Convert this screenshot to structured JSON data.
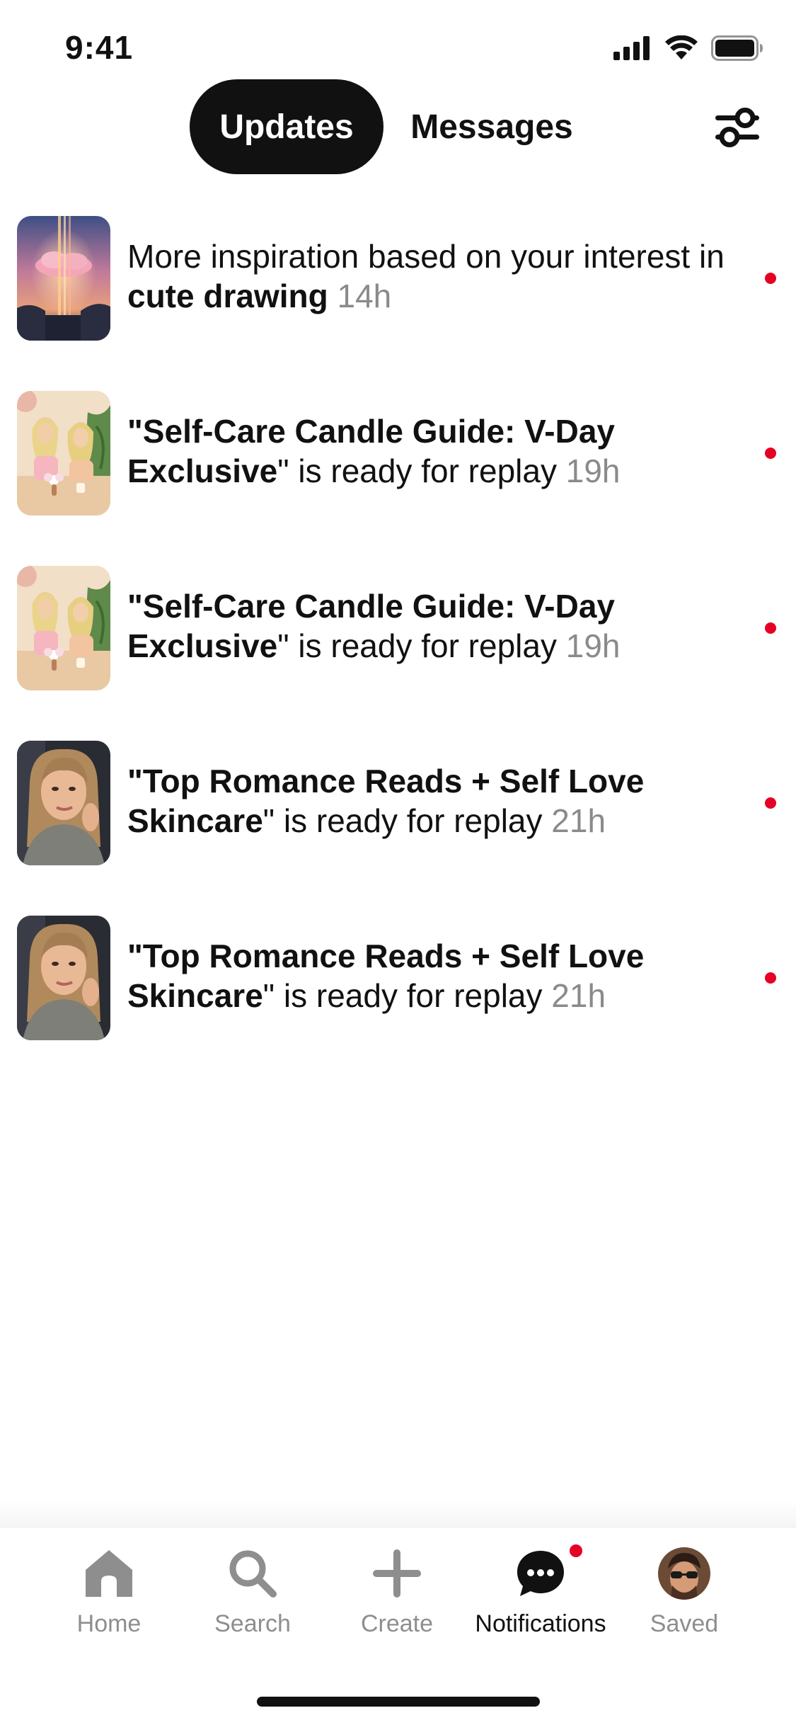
{
  "status_bar": {
    "time": "9:41"
  },
  "header": {
    "tabs": [
      {
        "label": "Updates",
        "active": true
      },
      {
        "label": "Messages",
        "active": false
      }
    ],
    "filter_icon": "sliders-icon"
  },
  "notifications": [
    {
      "prefix": "More inspiration based on your interest in ",
      "bold": "cute drawing",
      "suffix": " ",
      "time": "14h",
      "unread": true,
      "thumbnail": "cloud-light-pillars-art"
    },
    {
      "prefix": "",
      "bold": "\"Self-Care Candle Guide: V-Day Exclusive",
      "suffix": "\" is ready for replay ",
      "time": "19h",
      "unread": true,
      "thumbnail": "two-women-candles"
    },
    {
      "prefix": "",
      "bold": "\"Self-Care Candle Guide: V-Day Exclusive",
      "suffix": "\" is ready for replay ",
      "time": "19h",
      "unread": true,
      "thumbnail": "two-women-candles"
    },
    {
      "prefix": "",
      "bold": "\"Top Romance Reads + Self Love Skincare",
      "suffix": "\" is ready for replay ",
      "time": "21h",
      "unread": true,
      "thumbnail": "woman-selfie"
    },
    {
      "prefix": "",
      "bold": "\"Top Romance Reads + Self Love Skincare",
      "suffix": "\" is ready for replay ",
      "time": "21h",
      "unread": true,
      "thumbnail": "woman-selfie"
    }
  ],
  "bottom_nav": {
    "items": [
      {
        "label": "Home",
        "icon": "home-icon",
        "active": false
      },
      {
        "label": "Search",
        "icon": "search-icon",
        "active": false
      },
      {
        "label": "Create",
        "icon": "plus-icon",
        "active": false
      },
      {
        "label": "Notifications",
        "icon": "chat-bubble-icon",
        "active": true,
        "badge": true
      },
      {
        "label": "Saved",
        "icon": "profile-avatar",
        "active": false
      }
    ]
  },
  "colors": {
    "accent_red": "#e60023",
    "active_tab_bg": "#111111",
    "inactive_label": "#8e8e8e",
    "time_gray": "#8a8a8a"
  }
}
